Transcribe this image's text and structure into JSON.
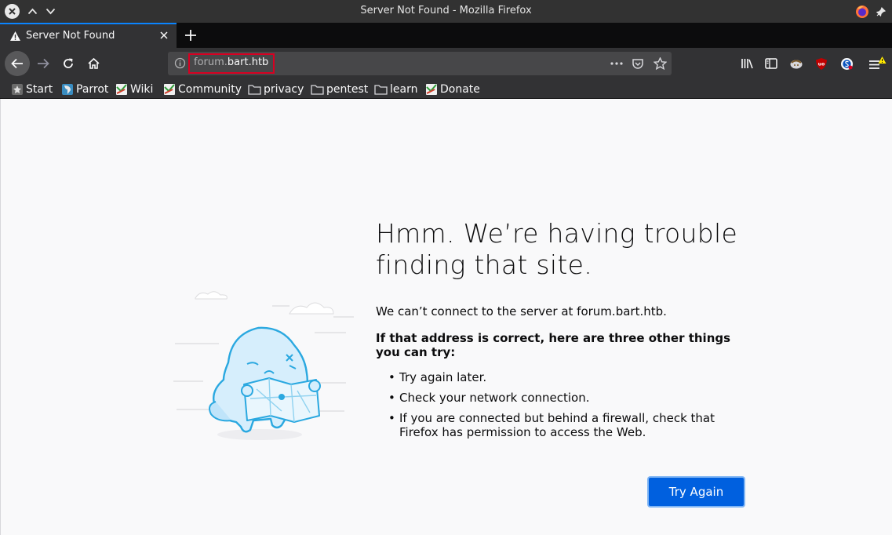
{
  "window": {
    "title": "Server Not Found - Mozilla Firefox"
  },
  "tab": {
    "label": "Server Not Found"
  },
  "urlbar": {
    "subdomain": "forum.",
    "domain": "bart.htb"
  },
  "bookmarks": [
    {
      "label": "Start",
      "icon": "star-icon"
    },
    {
      "label": "Parrot",
      "icon": "parrot-icon"
    },
    {
      "label": "Wiki",
      "icon": "wiki-icon"
    },
    {
      "label": "Community",
      "icon": "community-icon"
    },
    {
      "label": "privacy",
      "icon": "folder-icon"
    },
    {
      "label": "pentest",
      "icon": "folder-icon"
    },
    {
      "label": "learn",
      "icon": "folder-icon"
    },
    {
      "label": "Donate",
      "icon": "donate-icon"
    }
  ],
  "error": {
    "title": "Hmm. We’re having trouble finding that site.",
    "description": "We can’t connect to the server at forum.bart.htb.",
    "strong": "If that address is correct, here are three other things you can try:",
    "items": [
      "Try again later.",
      "Check your network connection.",
      "If you are connected but behind a firewall, check that Firefox has permission to access the Web."
    ],
    "button_label": "Try Again"
  },
  "colors": {
    "accent": "#0060df",
    "url_highlight": "#d70022",
    "toolbar": "#323234",
    "ublock": "#c10000"
  }
}
